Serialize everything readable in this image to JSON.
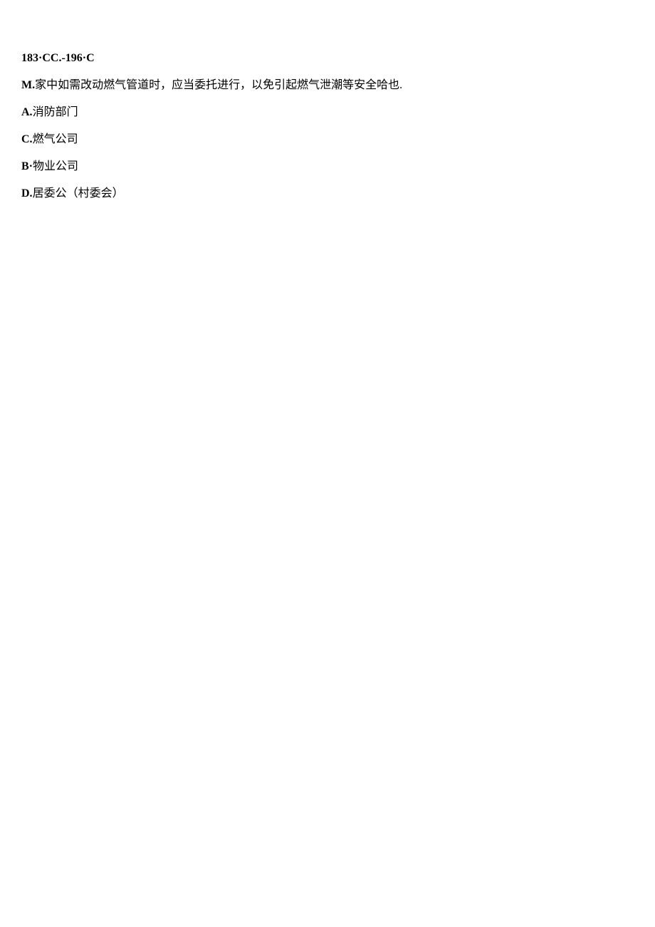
{
  "header": "183·CC.-196·C",
  "question": {
    "prefix": "M.",
    "text": "家中如需改动燃气管道时，应当委托进行，以免引起燃气泄潮等安全哈也."
  },
  "options": [
    {
      "prefix": "A.",
      "text": "消防部门"
    },
    {
      "prefix": "C.",
      "text": "燃气公司"
    },
    {
      "prefix": "B·",
      "text": "物业公司"
    },
    {
      "prefix": "D.",
      "text": "居委公（村委会）"
    }
  ]
}
